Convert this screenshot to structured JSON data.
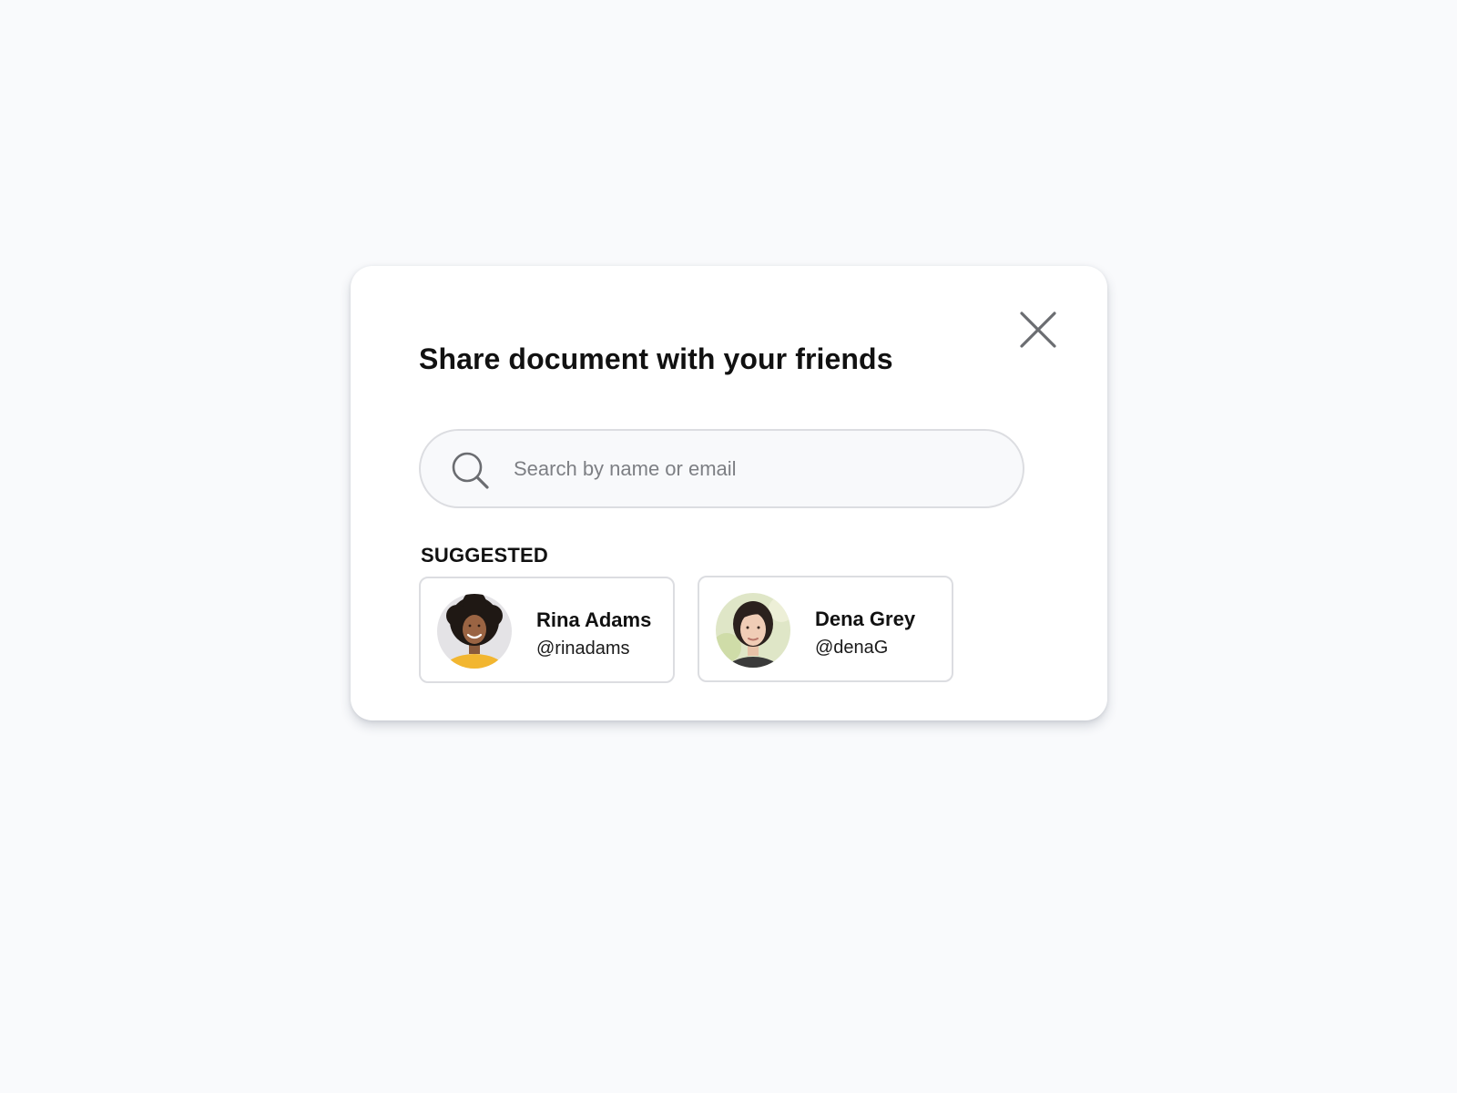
{
  "dialog": {
    "title": "Share document with your friends",
    "close_icon": "close-icon"
  },
  "search": {
    "icon": "search-icon",
    "placeholder": "Search by name or email",
    "value": ""
  },
  "suggested": {
    "label": "SUGGESTED",
    "people": [
      {
        "name": "Rina Adams",
        "handle": "@rinadams",
        "avatar": "avatar-photo"
      },
      {
        "name": "Dena Grey",
        "handle": "@denaG",
        "avatar": "avatar-photo"
      }
    ]
  },
  "colors": {
    "background": "#f9fafc",
    "dialog": "#ffffff",
    "border": "#dcdde1",
    "text": "#111111",
    "placeholder": "#7d7f84"
  }
}
